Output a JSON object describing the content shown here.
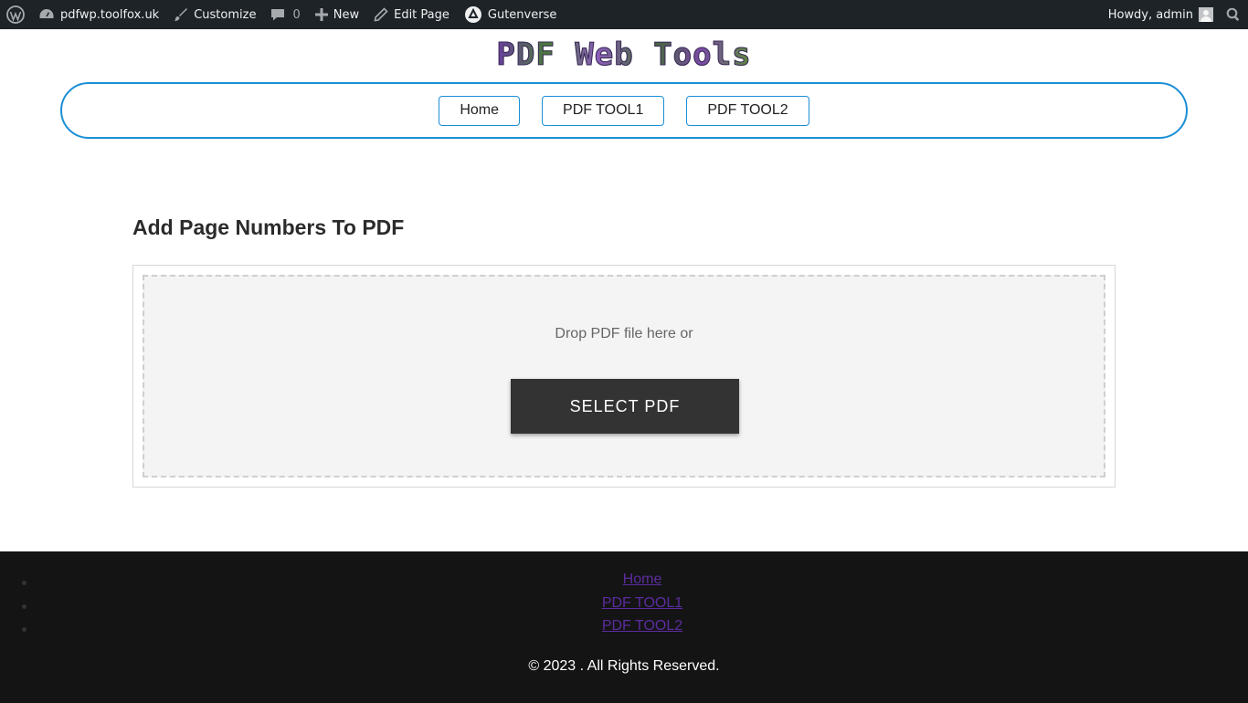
{
  "admin_bar": {
    "site_name": "pdfwp.toolfox.uk",
    "customize": "Customize",
    "comments": "0",
    "new": "New",
    "edit_page": "Edit Page",
    "gutenverse": "Gutenverse",
    "howdy": "Howdy, admin"
  },
  "header": {
    "logo_text": "PDF Web Tools",
    "nav": [
      "Home",
      "PDF TOOL1",
      "PDF TOOL2"
    ]
  },
  "main": {
    "title": "Add Page Numbers To PDF",
    "drop_text": "Drop PDF file here or",
    "select_button": "SELECT PDF"
  },
  "footer": {
    "menu": [
      "Home",
      "PDF TOOL1",
      "PDF TOOL2"
    ],
    "copyright": "© 2023 . All Rights Reserved."
  },
  "colors": {
    "admin_bar_bg": "#1d2327",
    "nav_accent": "#1a8fd6",
    "button_bg": "#333333",
    "footer_bg": "#141414",
    "footer_link": "#5b2c9e"
  }
}
